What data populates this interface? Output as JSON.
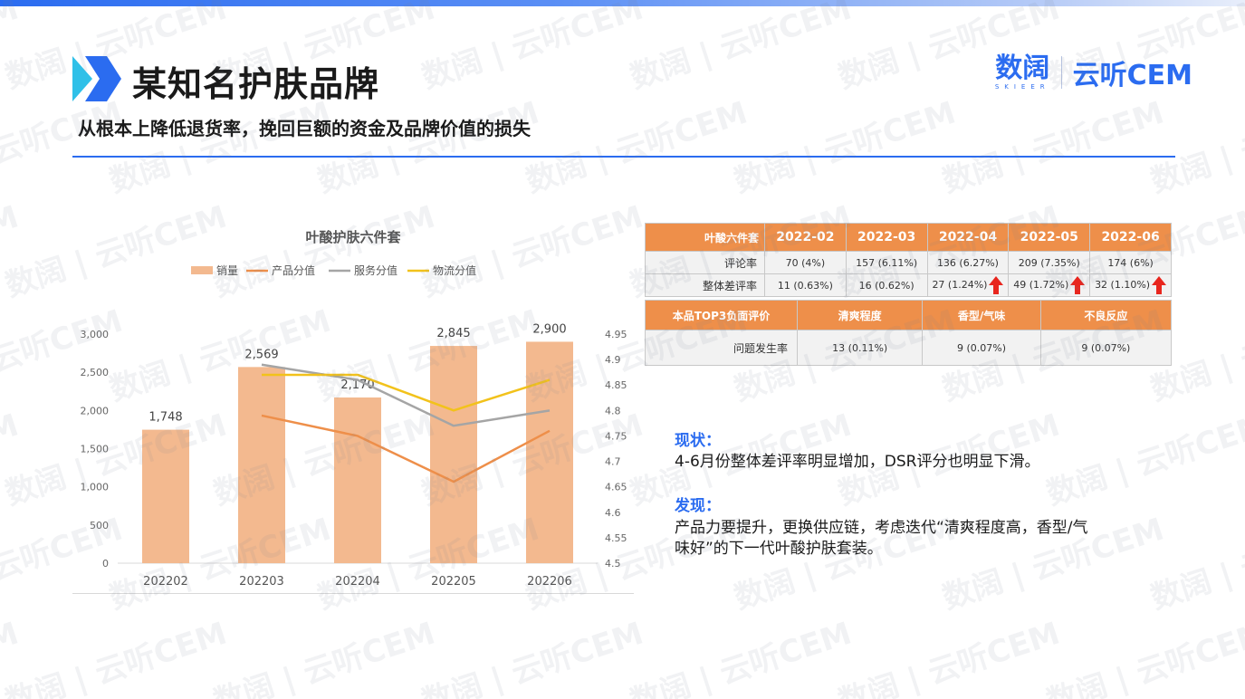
{
  "header": {
    "title": "某知名护肤品牌",
    "subtitle": "从根本上降低退货率，挽回巨额的资金及品牌价值的损失"
  },
  "brand": {
    "logo_cn": "数阔",
    "logo_en": "SKIEER",
    "name": "云听CEM",
    "watermark": "数阔 | 云听CEM"
  },
  "colors": {
    "accent_blue": "#2b6cf0",
    "orange": "#ee8f4a",
    "bar": "#f3b98f",
    "gray_line": "#a5a5a5",
    "yellow_line": "#f2c21b",
    "up_arrow": "#e8261e"
  },
  "chart_data": {
    "type": "bar",
    "title": "叶酸护肤六件套",
    "legend_position": "top",
    "categories": [
      "202202",
      "202203",
      "202204",
      "202205",
      "202206"
    ],
    "series": [
      {
        "name": "销量",
        "type": "bar",
        "axis": "left",
        "values": [
          1748,
          2569,
          2170,
          2845,
          2900
        ],
        "color": "#f3b98f"
      },
      {
        "name": "产品分值",
        "type": "line",
        "axis": "right",
        "values": [
          null,
          4.79,
          4.75,
          4.66,
          4.76
        ],
        "color": "#ee8f4a"
      },
      {
        "name": "服务分值",
        "type": "line",
        "axis": "right",
        "values": [
          null,
          4.89,
          4.86,
          4.77,
          4.8
        ],
        "color": "#a5a5a5"
      },
      {
        "name": "物流分值",
        "type": "line",
        "axis": "right",
        "values": [
          null,
          4.87,
          4.87,
          4.8,
          4.86
        ],
        "color": "#f2c21b"
      }
    ],
    "bar_labels": [
      "1,748",
      "2,569",
      "2,170",
      "2,845",
      "2,900"
    ],
    "y_left": {
      "ticks": [
        "0",
        "500",
        "1,000",
        "1,500",
        "2,000",
        "2,500",
        "3,000"
      ],
      "ylim": [
        0,
        3000
      ]
    },
    "y_right": {
      "ticks": [
        "4.5",
        "4.55",
        "4.6",
        "4.65",
        "4.7",
        "4.75",
        "4.8",
        "4.85",
        "4.9",
        "4.95"
      ],
      "ylim": [
        4.5,
        4.95
      ]
    },
    "grid": false
  },
  "table1": {
    "header": [
      "叶酸六件套",
      "2022-02",
      "2022-03",
      "2022-04",
      "2022-05",
      "2022-06"
    ],
    "rows": [
      {
        "label": "评论率",
        "cells": [
          "70 (4%)",
          "157 (6.11%)",
          "136 (6.27%)",
          "209 (7.35%)",
          "174 (6%)"
        ]
      },
      {
        "label": "整体差评率",
        "cells": [
          "11 (0.63%)",
          "16 (0.62%)",
          "27 (1.24%)",
          "49 (1.72%)",
          "32 (1.10%)"
        ],
        "arrows": [
          false,
          false,
          true,
          true,
          true
        ]
      }
    ]
  },
  "table2": {
    "header": [
      "本品TOP3负面评价",
      "清爽程度",
      "香型/气味",
      "不良反应"
    ],
    "row": {
      "label": "问题发生率",
      "cells": [
        "13 (0.11%)",
        "9 (0.07%)",
        "9 (0.07%)"
      ]
    }
  },
  "notes": {
    "status_heading": "现状：",
    "status_text": "4-6月份整体差评率明显增加，DSR评分也明显下滑。",
    "finding_heading": "发现：",
    "finding_text_1": "产品力要提升，更换供应链，考虑迭代“清爽程度高，香型/气",
    "finding_text_2": "味好”的下一代叶酸护肤套装。"
  }
}
